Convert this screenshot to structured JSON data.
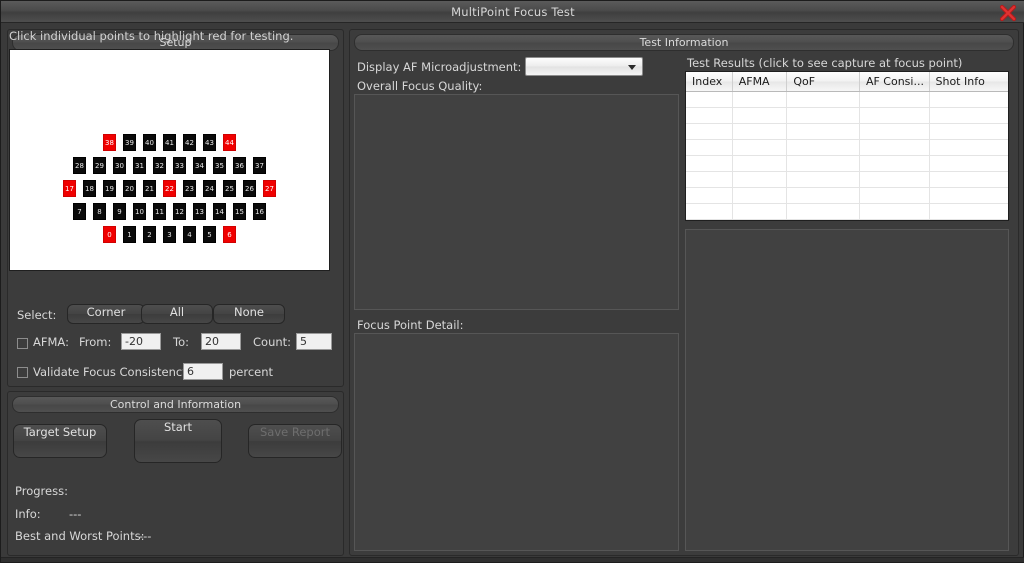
{
  "window": {
    "title": "MultiPoint Focus Test",
    "close_icon": "close-icon"
  },
  "setup": {
    "header": "Setup",
    "hint": "Click individual points to highlight red for testing.",
    "focus_grid": {
      "rows": [
        {
          "points": [
            {
              "label": "38",
              "selected": true
            },
            {
              "label": "39",
              "selected": false
            },
            {
              "label": "40",
              "selected": false
            },
            {
              "label": "41",
              "selected": false
            },
            {
              "label": "42",
              "selected": false
            },
            {
              "label": "43",
              "selected": false
            },
            {
              "label": "44",
              "selected": true
            }
          ]
        },
        {
          "points": [
            {
              "label": "28",
              "selected": false
            },
            {
              "label": "29",
              "selected": false
            },
            {
              "label": "30",
              "selected": false
            },
            {
              "label": "31",
              "selected": false
            },
            {
              "label": "32",
              "selected": false
            },
            {
              "label": "33",
              "selected": false
            },
            {
              "label": "34",
              "selected": false
            },
            {
              "label": "35",
              "selected": false
            },
            {
              "label": "36",
              "selected": false
            },
            {
              "label": "37",
              "selected": false
            }
          ]
        },
        {
          "points": [
            {
              "label": "17",
              "selected": true
            },
            {
              "label": "18",
              "selected": false
            },
            {
              "label": "19",
              "selected": false
            },
            {
              "label": "20",
              "selected": false
            },
            {
              "label": "21",
              "selected": false
            },
            {
              "label": "22",
              "selected": true
            },
            {
              "label": "23",
              "selected": false
            },
            {
              "label": "24",
              "selected": false
            },
            {
              "label": "25",
              "selected": false
            },
            {
              "label": "26",
              "selected": false
            },
            {
              "label": "27",
              "selected": true
            }
          ]
        },
        {
          "points": [
            {
              "label": "7",
              "selected": false
            },
            {
              "label": "8",
              "selected": false
            },
            {
              "label": "9",
              "selected": false
            },
            {
              "label": "10",
              "selected": false
            },
            {
              "label": "11",
              "selected": false
            },
            {
              "label": "12",
              "selected": false
            },
            {
              "label": "13",
              "selected": false
            },
            {
              "label": "14",
              "selected": false
            },
            {
              "label": "15",
              "selected": false
            },
            {
              "label": "16",
              "selected": false
            }
          ]
        },
        {
          "points": [
            {
              "label": "0",
              "selected": true
            },
            {
              "label": "1",
              "selected": false
            },
            {
              "label": "2",
              "selected": false
            },
            {
              "label": "3",
              "selected": false
            },
            {
              "label": "4",
              "selected": false
            },
            {
              "label": "5",
              "selected": false
            },
            {
              "label": "6",
              "selected": true
            }
          ]
        }
      ],
      "selected_color": "#f00000",
      "unselected_color": "#0a0a0a",
      "canvas_color": "#ffffff"
    },
    "select_label": "Select:",
    "select_corner": "Corner",
    "select_all": "All",
    "select_none": "None",
    "afma_label": "AFMA:",
    "afma_checked": false,
    "from_label": "From:",
    "from_value": "-20",
    "to_label": "To:",
    "to_value": "20",
    "count_label": "Count:",
    "count_value": "5",
    "validate_label": "Validate Focus Consistency to",
    "validate_checked": false,
    "validate_value": "6",
    "percent_label": "percent"
  },
  "control": {
    "header": "Control and Information",
    "target_setup": "Target Setup",
    "start": "Start",
    "save_report": "Save Report",
    "save_report_enabled": false,
    "progress_label": "Progress:",
    "progress_value": "",
    "info_label": "Info:",
    "info_value": "---",
    "best_worst_label": "Best and Worst Points:",
    "best_worst_value": "---"
  },
  "test_information": {
    "header": "Test Information",
    "display_afma_label": "Display AF Microadjustment:",
    "display_afma_value": "",
    "display_afma_placeholder": "",
    "overall_focus_quality_label": "Overall Focus Quality:",
    "overall_focus_quality_value": "",
    "focus_point_detail_label": "Focus Point Detail:",
    "focus_point_detail_value": "",
    "results_caption": "Test Results (click to see capture at focus point)",
    "results_columns": [
      "Index",
      "AFMA",
      "QoF",
      "AF Consi...",
      "Shot Info"
    ],
    "results_rows": [],
    "empty_row_count": 8,
    "preview_value": ""
  }
}
